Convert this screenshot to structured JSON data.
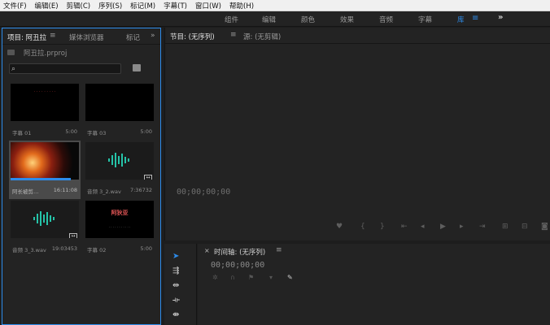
{
  "menu": [
    "文件(F)",
    "编辑(E)",
    "剪辑(C)",
    "序列(S)",
    "标记(M)",
    "字幕(T)",
    "窗口(W)",
    "帮助(H)"
  ],
  "workspace": {
    "tabs": [
      "组件",
      "编辑",
      "颜色",
      "效果",
      "音频",
      "字幕",
      "库"
    ],
    "active": "库"
  },
  "project_panel": {
    "tab_project": "项目: 阿丑拉",
    "tab_media_browser": "媒体浏览器",
    "tab_markers": "标记",
    "file": "阿丑拉.prproj",
    "search_placeholder": "",
    "items": [
      {
        "name": "字幕 01",
        "duration": "5:00",
        "type": "title"
      },
      {
        "name": "字幕 03",
        "duration": "5:00",
        "type": "title"
      },
      {
        "name": "阿长被剪…",
        "duration": "16:11:08",
        "type": "video"
      },
      {
        "name": "音频 3_2.wav",
        "duration": "7:36732",
        "type": "audio"
      },
      {
        "name": "音频 3_3.wav",
        "duration": "19:03453",
        "type": "audio"
      },
      {
        "name": "字幕 02",
        "duration": "5:00",
        "type": "title"
      }
    ],
    "thumb_title_text": "阿狄亚"
  },
  "monitor": {
    "tab_program": "节目: (无序列)",
    "tab_source": "源: (无剪辑)",
    "timecode": "00;00;00;00"
  },
  "timeline": {
    "tab": "时间轴: (无序列)",
    "timecode": "00;00;00;00"
  },
  "colors": {
    "accent": "#2d8ceb",
    "panel": "#232323",
    "bg": "#1d1d1d"
  }
}
